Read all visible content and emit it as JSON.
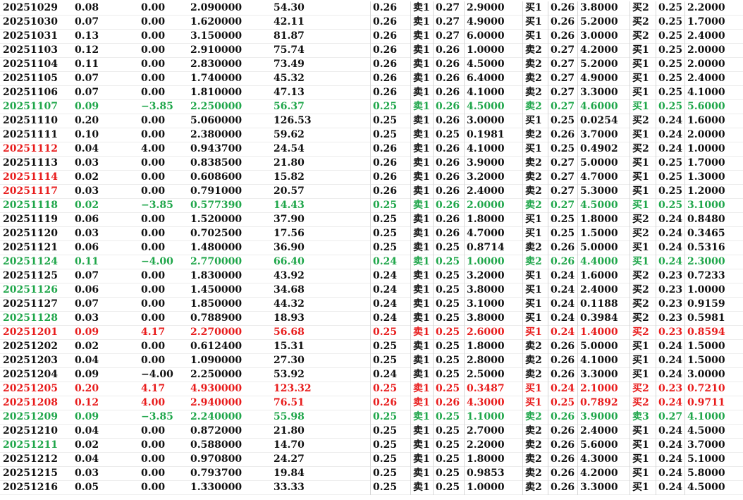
{
  "colors": {
    "black": "#111111",
    "green": "#1fa64a",
    "red": "#e81c1c"
  },
  "rows": [
    {
      "color": "black",
      "c": [
        "20251029",
        "0.08",
        "0.00",
        "2.090000",
        "54.30",
        "0.26",
        "卖1",
        "0.27",
        "2.9000",
        "买1",
        "0.26",
        "3.8000",
        "买2",
        "0.25",
        "2.2000"
      ]
    },
    {
      "color": "black",
      "c": [
        "20251030",
        "0.07",
        "0.00",
        "1.620000",
        "42.11",
        "0.26",
        "卖1",
        "0.27",
        "4.9000",
        "买1",
        "0.26",
        "5.2000",
        "买2",
        "0.25",
        "1.7000"
      ]
    },
    {
      "color": "black",
      "c": [
        "20251031",
        "0.13",
        "0.00",
        "3.150000",
        "81.87",
        "0.26",
        "卖1",
        "0.27",
        "6.0000",
        "买1",
        "0.26",
        "3.0000",
        "买2",
        "0.25",
        "2.4000"
      ]
    },
    {
      "color": "black",
      "c": [
        "20251103",
        "0.12",
        "0.00",
        "2.910000",
        "75.74",
        "0.26",
        "卖1",
        "0.26",
        "1.0000",
        "卖2",
        "0.27",
        "4.2000",
        "买1",
        "0.25",
        "2.0000"
      ]
    },
    {
      "color": "black",
      "c": [
        "20251104",
        "0.11",
        "0.00",
        "2.830000",
        "73.49",
        "0.26",
        "卖1",
        "0.26",
        "4.5000",
        "卖2",
        "0.27",
        "5.2000",
        "买1",
        "0.25",
        "2.0000"
      ]
    },
    {
      "color": "black",
      "c": [
        "20251105",
        "0.07",
        "0.00",
        "1.740000",
        "45.32",
        "0.26",
        "卖1",
        "0.26",
        "6.4000",
        "卖2",
        "0.27",
        "4.9000",
        "买1",
        "0.25",
        "2.4000"
      ]
    },
    {
      "color": "black",
      "c": [
        "20251106",
        "0.07",
        "0.00",
        "1.810000",
        "47.13",
        "0.26",
        "卖1",
        "0.26",
        "4.1000",
        "卖2",
        "0.27",
        "3.3000",
        "买1",
        "0.25",
        "4.1000"
      ]
    },
    {
      "color": "green",
      "c": [
        "20251107",
        "0.09",
        "−3.85",
        "2.250000",
        "56.37",
        "0.25",
        "卖1",
        "0.26",
        "4.5000",
        "卖2",
        "0.27",
        "4.6000",
        "买1",
        "0.25",
        "5.6000"
      ]
    },
    {
      "color": "black",
      "c": [
        "20251110",
        "0.20",
        "0.00",
        "5.060000",
        "126.53",
        "0.25",
        "卖1",
        "0.26",
        "3.0000",
        "买1",
        "0.25",
        "0.0254",
        "买2",
        "0.24",
        "1.6000"
      ]
    },
    {
      "color": "black",
      "c": [
        "20251111",
        "0.10",
        "0.00",
        "2.380000",
        "59.62",
        "0.25",
        "卖1",
        "0.25",
        "0.1981",
        "卖2",
        "0.26",
        "3.7000",
        "买1",
        "0.24",
        "2.0000"
      ]
    },
    {
      "color": "red",
      "first_only": true,
      "c": [
        "20251112",
        "0.04",
        "4.00",
        "0.943700",
        "24.54",
        "0.26",
        "卖1",
        "0.26",
        "4.1000",
        "买1",
        "0.25",
        "0.4902",
        "买2",
        "0.24",
        "1.0000"
      ]
    },
    {
      "color": "black",
      "c": [
        "20251113",
        "0.03",
        "0.00",
        "0.838500",
        "21.80",
        "0.26",
        "卖1",
        "0.26",
        "3.9000",
        "卖2",
        "0.27",
        "5.0000",
        "买1",
        "0.25",
        "1.7000"
      ]
    },
    {
      "color": "red",
      "first_only": true,
      "c": [
        "20251114",
        "0.02",
        "0.00",
        "0.608600",
        "15.82",
        "0.26",
        "卖1",
        "0.26",
        "3.2000",
        "卖2",
        "0.27",
        "4.7000",
        "买1",
        "0.25",
        "1.3000"
      ]
    },
    {
      "color": "red",
      "first_only": true,
      "c": [
        "20251117",
        "0.03",
        "0.00",
        "0.791000",
        "20.57",
        "0.26",
        "卖1",
        "0.26",
        "2.4000",
        "卖2",
        "0.27",
        "5.3000",
        "买1",
        "0.25",
        "1.2000"
      ]
    },
    {
      "color": "green",
      "c": [
        "20251118",
        "0.02",
        "−3.85",
        "0.577390",
        "14.43",
        "0.25",
        "卖1",
        "0.26",
        "2.0000",
        "卖2",
        "0.27",
        "4.5000",
        "买1",
        "0.25",
        "3.1000"
      ]
    },
    {
      "color": "black",
      "c": [
        "20251119",
        "0.06",
        "0.00",
        "1.520000",
        "37.90",
        "0.25",
        "卖1",
        "0.26",
        "1.8000",
        "买1",
        "0.25",
        "1.8000",
        "买2",
        "0.24",
        "0.8480"
      ]
    },
    {
      "color": "black",
      "c": [
        "20251120",
        "0.03",
        "0.00",
        "0.702500",
        "17.56",
        "0.25",
        "卖1",
        "0.26",
        "4.7000",
        "买1",
        "0.25",
        "1.5000",
        "买2",
        "0.24",
        "0.3465"
      ]
    },
    {
      "color": "black",
      "c": [
        "20251121",
        "0.06",
        "0.00",
        "1.480000",
        "36.90",
        "0.25",
        "卖1",
        "0.25",
        "0.8714",
        "卖2",
        "0.26",
        "5.0000",
        "买1",
        "0.24",
        "0.5316"
      ]
    },
    {
      "color": "green",
      "c": [
        "20251124",
        "0.11",
        "−4.00",
        "2.770000",
        "66.40",
        "0.24",
        "卖1",
        "0.25",
        "1.0000",
        "卖2",
        "0.26",
        "4.4000",
        "买1",
        "0.24",
        "2.3000"
      ]
    },
    {
      "color": "black",
      "c": [
        "20251125",
        "0.07",
        "0.00",
        "1.830000",
        "43.92",
        "0.24",
        "卖1",
        "0.25",
        "3.2000",
        "买1",
        "0.24",
        "1.6000",
        "买2",
        "0.23",
        "0.7233"
      ]
    },
    {
      "color": "green",
      "first_only": true,
      "c": [
        "20251126",
        "0.06",
        "0.00",
        "1.450000",
        "34.68",
        "0.24",
        "卖1",
        "0.25",
        "3.8000",
        "买1",
        "0.24",
        "2.4000",
        "买2",
        "0.23",
        "1.0000"
      ]
    },
    {
      "color": "black",
      "c": [
        "20251127",
        "0.07",
        "0.00",
        "1.850000",
        "44.32",
        "0.24",
        "卖1",
        "0.25",
        "3.1000",
        "买1",
        "0.24",
        "0.1188",
        "买2",
        "0.23",
        "0.9159"
      ]
    },
    {
      "color": "green",
      "first_only": true,
      "c": [
        "20251128",
        "0.03",
        "0.00",
        "0.788900",
        "18.93",
        "0.24",
        "卖1",
        "0.25",
        "3.8000",
        "买1",
        "0.24",
        "0.3984",
        "买2",
        "0.23",
        "0.5981"
      ]
    },
    {
      "color": "red",
      "c": [
        "20251201",
        "0.09",
        "4.17",
        "2.270000",
        "56.68",
        "0.25",
        "卖1",
        "0.25",
        "2.6000",
        "买1",
        "0.24",
        "1.4000",
        "买2",
        "0.23",
        "0.8594"
      ]
    },
    {
      "color": "black",
      "c": [
        "20251202",
        "0.02",
        "0.00",
        "0.612400",
        "15.31",
        "0.25",
        "卖1",
        "0.25",
        "1.8000",
        "卖2",
        "0.26",
        "5.0000",
        "买1",
        "0.24",
        "1.5000"
      ]
    },
    {
      "color": "black",
      "c": [
        "20251203",
        "0.04",
        "0.00",
        "1.090000",
        "27.30",
        "0.25",
        "卖1",
        "0.25",
        "2.8000",
        "卖2",
        "0.26",
        "4.1000",
        "买1",
        "0.24",
        "1.5000"
      ]
    },
    {
      "color": "black",
      "c": [
        "20251204",
        "0.09",
        "−4.00",
        "2.250000",
        "53.92",
        "0.24",
        "卖1",
        "0.25",
        "2.5000",
        "卖2",
        "0.26",
        "3.3000",
        "买1",
        "0.24",
        "3.0000"
      ]
    },
    {
      "color": "red",
      "c": [
        "20251205",
        "0.20",
        "4.17",
        "4.930000",
        "123.32",
        "0.25",
        "卖1",
        "0.25",
        "0.3487",
        "买1",
        "0.24",
        "2.1000",
        "买2",
        "0.23",
        "0.7210"
      ]
    },
    {
      "color": "red",
      "c": [
        "20251208",
        "0.12",
        "4.00",
        "2.940000",
        "76.51",
        "0.26",
        "卖1",
        "0.26",
        "4.3000",
        "买1",
        "0.25",
        "0.7892",
        "买2",
        "0.24",
        "0.9711"
      ]
    },
    {
      "color": "green",
      "c": [
        "20251209",
        "0.09",
        "−3.85",
        "2.240000",
        "55.98",
        "0.25",
        "卖1",
        "0.25",
        "1.1000",
        "卖2",
        "0.26",
        "3.9000",
        "卖3",
        "0.27",
        "4.1000"
      ]
    },
    {
      "color": "black",
      "c": [
        "20251210",
        "0.04",
        "0.00",
        "0.872000",
        "21.80",
        "0.25",
        "卖1",
        "0.25",
        "2.7000",
        "卖2",
        "0.26",
        "2.4000",
        "买1",
        "0.24",
        "4.5000"
      ]
    },
    {
      "color": "green",
      "first_only": true,
      "c": [
        "20251211",
        "0.02",
        "0.00",
        "0.588000",
        "14.70",
        "0.25",
        "卖1",
        "0.25",
        "2.2000",
        "卖2",
        "0.26",
        "5.6000",
        "买1",
        "0.24",
        "3.7000"
      ]
    },
    {
      "color": "black",
      "c": [
        "20251212",
        "0.04",
        "0.00",
        "0.970800",
        "24.27",
        "0.25",
        "卖1",
        "0.25",
        "1.8000",
        "卖2",
        "0.26",
        "4.3000",
        "买1",
        "0.24",
        "5.1000"
      ]
    },
    {
      "color": "black",
      "c": [
        "20251215",
        "0.03",
        "0.00",
        "0.793700",
        "19.84",
        "0.25",
        "卖1",
        "0.25",
        "0.9853",
        "卖2",
        "0.26",
        "4.2000",
        "买1",
        "0.24",
        "5.8000"
      ]
    },
    {
      "color": "black",
      "c": [
        "20251216",
        "0.05",
        "0.00",
        "1.330000",
        "33.33",
        "0.25",
        "卖1",
        "0.25",
        "1.0000",
        "卖2",
        "0.26",
        "3.3000",
        "买1",
        "0.24",
        "4.5000"
      ]
    }
  ]
}
